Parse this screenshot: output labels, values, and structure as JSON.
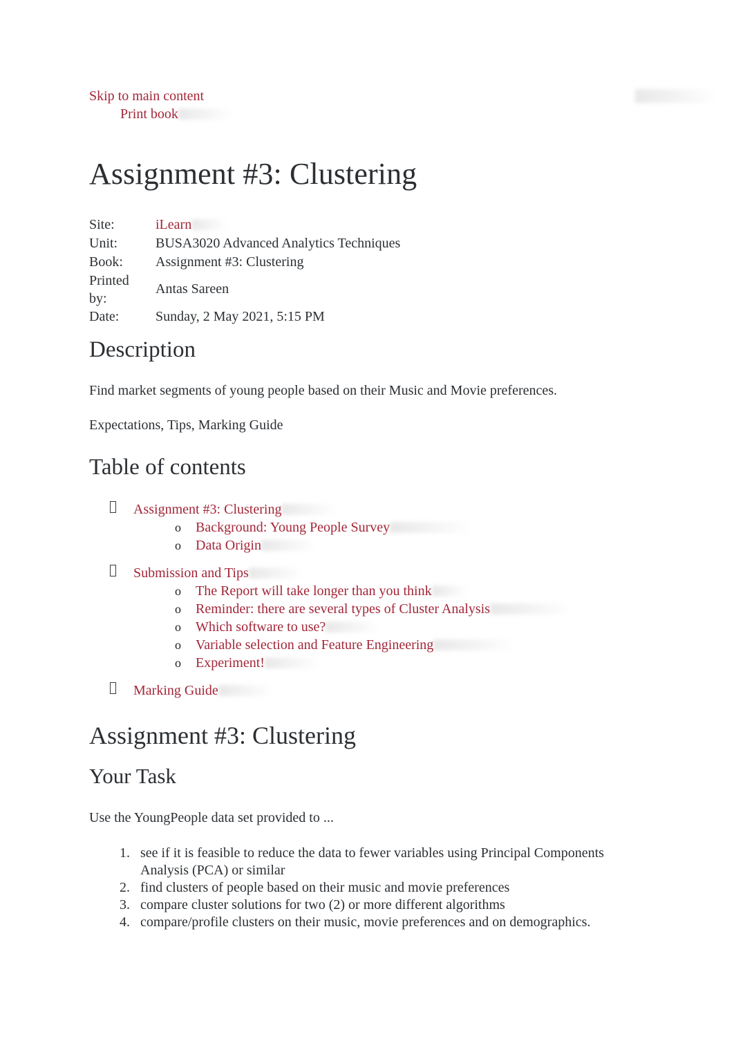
{
  "header": {
    "skip_link": "Skip to main content",
    "print_link": "Print book"
  },
  "document": {
    "title": "Assignment #3: Clustering"
  },
  "meta": {
    "rows": [
      {
        "label": "Site:",
        "value": "iLearn",
        "is_link": true
      },
      {
        "label": "Unit:",
        "value": "BUSA3020 Advanced Analytics Techniques",
        "is_link": false
      },
      {
        "label": "Book:",
        "value": "Assignment #3: Clustering",
        "is_link": false
      },
      {
        "label": "Printed by:",
        "value": "Antas Sareen",
        "is_link": false
      },
      {
        "label": "Date:",
        "value": "Sunday, 2 May 2021, 5:15 PM",
        "is_link": false
      }
    ],
    "site_label": "Site:",
    "site_value": "iLearn",
    "unit_label": "Unit:",
    "unit_value": "BUSA3020 Advanced Analytics Techniques",
    "book_label": "Book:",
    "book_value": "Assignment #3: Clustering",
    "printed_by_label_line1": "Printed",
    "printed_by_label_line2": "by:",
    "printed_by_value": "Antas Sareen",
    "date_label": "Date:",
    "date_value": "Sunday, 2 May 2021, 5:15 PM"
  },
  "description": {
    "heading": "Description",
    "paragraph_1": "Find market segments of young people based on their Music and Movie preferences.",
    "paragraph_2": "Expectations, Tips, Marking Guide"
  },
  "toc": {
    "heading": "Table of contents",
    "items": [
      {
        "label": "Assignment #3: Clustering",
        "children": [
          {
            "label": "Background: Young People Survey"
          },
          {
            "label": "Data Origin"
          }
        ]
      },
      {
        "label": "Submission and Tips",
        "children": [
          {
            "label": "The Report will take longer than you think"
          },
          {
            "label": "Reminder: there are several types of Cluster Analysis"
          },
          {
            "label": "Which software to use?"
          },
          {
            "label": "Variable selection and Feature Engineering"
          },
          {
            "label": "Experiment!"
          }
        ]
      },
      {
        "label": "Marking Guide",
        "children": []
      }
    ]
  },
  "section": {
    "heading": "Assignment #3: Clustering",
    "subheading": "Your Task",
    "intro": "Use the YoungPeople data set provided to ...",
    "tasks": [
      "see if it is feasible to reduce the data to fewer variables using Principal Components Analysis (PCA) or similar",
      "find clusters of people based on their music and movie preferences",
      "compare cluster solutions for two (2) or more different algorithms",
      "compare/profile clusters on their music, movie preferences and on demographics."
    ]
  },
  "colors": {
    "link": "#a32638",
    "text": "#2b2f33",
    "background": "#ffffff"
  }
}
